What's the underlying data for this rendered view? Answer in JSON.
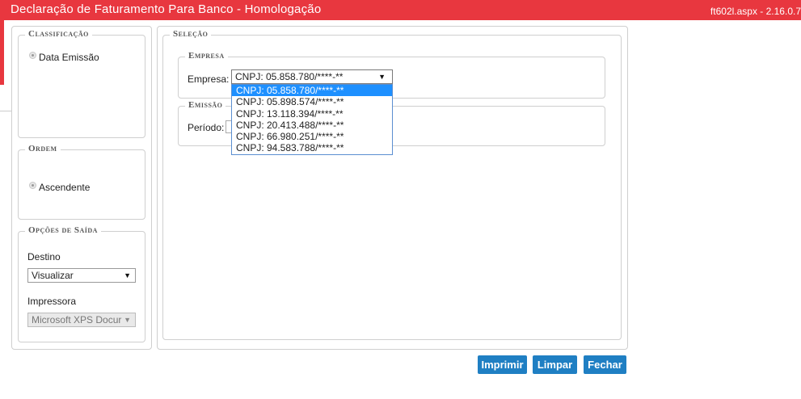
{
  "header": {
    "title": "Declaração de Faturamento Para Banco  - Homologação",
    "version": "ft602l.aspx - 2.16.0.7"
  },
  "classificacao": {
    "legend": "Classificação",
    "option": "Data Emissão"
  },
  "ordem": {
    "legend": "Ordem",
    "option": "Ascendente"
  },
  "opcoes_saida": {
    "legend": "Opções de Saída",
    "destino_label": "Destino",
    "destino_value": "Visualizar",
    "impressora_label": "Impressora",
    "impressora_value": "Microsoft XPS Docur"
  },
  "selecao": {
    "legend": "Seleção",
    "empresa": {
      "legend": "Empresa",
      "label": "Empresa:",
      "selected": "CNPJ: 05.858.780/****-**",
      "options": [
        "CNPJ: 05.858.780/****-**",
        "CNPJ: 05.898.574/****-**",
        "CNPJ: 13.118.394/****-**",
        "CNPJ: 20.413.488/****-**",
        "CNPJ: 66.980.251/****-**",
        "CNPJ: 94.583.788/****-**"
      ]
    },
    "emissao": {
      "legend": "Emissão",
      "periodo_label": "Período:"
    }
  },
  "actions": {
    "imprimir": "Imprimir",
    "limpar": "Limpar",
    "fechar": "Fechar"
  },
  "colors": {
    "header_bg": "#e8373f",
    "button_bg": "#1f7fc3",
    "selected_option_bg": "#1e90ff"
  }
}
